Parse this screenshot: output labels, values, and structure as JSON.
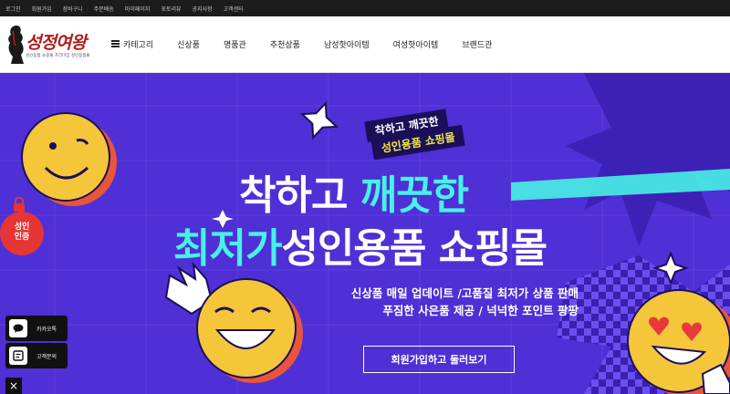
{
  "topbar": {
    "links": [
      "로그인",
      "회원가입",
      "장바구니",
      "주문배송",
      "마이페이지",
      "포토리뷰",
      "공지사항",
      "고객센터"
    ]
  },
  "header": {
    "logo_text": "성정여왕",
    "logo_sub": "성인용품 쇼핑몰 프리미엄 성인용품몰",
    "nav": [
      "카테고리",
      "신상품",
      "명품관",
      "추천상품",
      "남성핫아이템",
      "여성핫아이템",
      "브랜드관"
    ]
  },
  "hero": {
    "badge_line1": "착하고 깨끗한",
    "badge_line2": "성인용품 쇼핑몰",
    "headline1_white": "착하고 ",
    "headline1_cyan": "깨끗한",
    "headline2_cyan": "최저가",
    "headline2_white": "성인용품 쇼핑몰",
    "desc_line1": "신상품 매일 업데이트 /고품질 최저가 상품 판매",
    "desc_line2": "푸짐한 사은품 제공 / 넉넉한 포인트 팡팡",
    "cta": "회원가입하고 둘러보기",
    "colors": {
      "background": "#4f2fd6",
      "accent_cyan": "#48f1e6",
      "accent_yellow": "#f4e84a",
      "smiley": "#f5c53a"
    }
  },
  "adult_badge": {
    "line1": "성인",
    "line2": "인증"
  },
  "side": {
    "kakao_label": "카카오톡",
    "service_label": "고객문의",
    "close_label": "×"
  }
}
